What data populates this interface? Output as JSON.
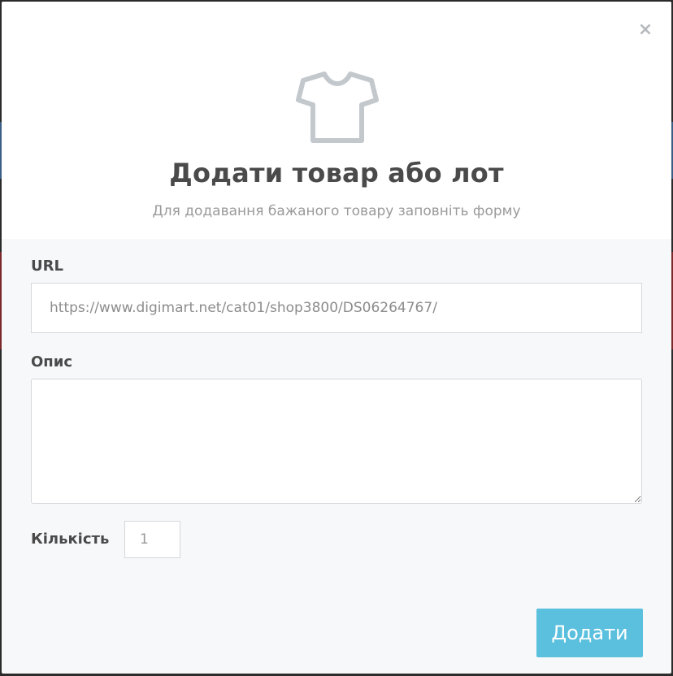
{
  "modal": {
    "close_label": "×",
    "icon": "tshirt-icon",
    "title": "Додати товар або лот",
    "subtitle": "Для додавання бажаного товару заповніть форму"
  },
  "form": {
    "url_label": "URL",
    "url_value": "https://www.digimart.net/cat01/shop3800/DS06264767/",
    "description_label": "Опис",
    "description_value": "",
    "quantity_label": "Кількість",
    "quantity_value": "1",
    "submit_label": "Додати"
  },
  "colors": {
    "accent": "#5bc0de",
    "title": "#4a4a4a",
    "subtitle": "#9a9a9a",
    "icon": "#c3c8cd"
  }
}
